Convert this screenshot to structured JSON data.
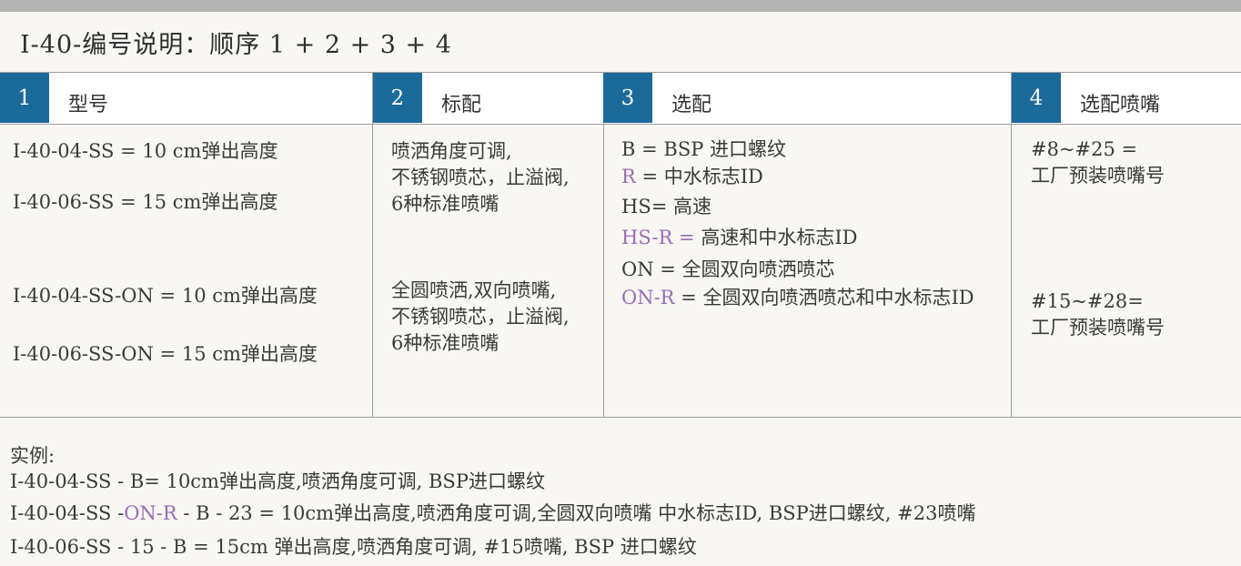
{
  "title": "I-40-编号说明：顺序 1 + 2 + 3 + 4",
  "columns": [
    {
      "num": "1",
      "label": "型号"
    },
    {
      "num": "2",
      "label": "标配"
    },
    {
      "num": "3",
      "label": "选配"
    },
    {
      "num": "4",
      "label": "选配喷嘴"
    }
  ],
  "col1": [
    "I-40-04-SS = 10 cm弹出高度",
    "I-40-06-SS = 15 cm弹出高度",
    "I-40-04-SS-ON = 10 cm弹出高度",
    "I-40-06-SS-ON = 15 cm弹出高度"
  ],
  "col2": {
    "block1": [
      "喷洒角度可调,",
      "不锈钢喷芯，止溢阀,",
      "6种标准喷嘴"
    ],
    "block2": [
      "全圆喷洒,双向喷嘴,",
      "不锈钢喷芯，止溢阀,",
      "6种标准喷嘴"
    ]
  },
  "col3": [
    {
      "code": "B",
      "desc": " = BSP 进口螺纹"
    },
    {
      "code": "R",
      "desc": " = 中水标志ID"
    },
    {
      "code": "HS",
      "desc": "= 高速"
    },
    {
      "code": "HS-R =",
      "desc": " 高速和中水标志ID"
    },
    {
      "code": "ON",
      "desc": " = 全圆双向喷洒喷芯"
    },
    {
      "code": "ON-R",
      "desc": " = 全圆双向喷洒喷芯和中水标志ID"
    }
  ],
  "col4": {
    "block1": [
      "#8~#25 =",
      "工厂预装喷嘴号"
    ],
    "block2": [
      "#15~#28=",
      "工厂预装喷嘴号"
    ]
  },
  "examples": {
    "heading": "实例:",
    "line1": "I-40-04-SS - B= 10cm弹出高度,喷洒角度可调, BSP进口螺纹",
    "line2_a": "I-40-04-SS -",
    "line2_b": "ON-R",
    "line2_c": " - B - 23 = 10cm弹出高度,喷洒角度可调,全圆双向喷嘴 中水标志ID, BSP进口螺纹, #23喷嘴",
    "line3": "I-40-06-SS - 15 - B = 15cm 弹出高度,喷洒角度可调, #15喷嘴, BSP 进口螺纹"
  },
  "colors": {
    "accent": "#1c6a9a",
    "highlight": "#9b6bb6"
  }
}
